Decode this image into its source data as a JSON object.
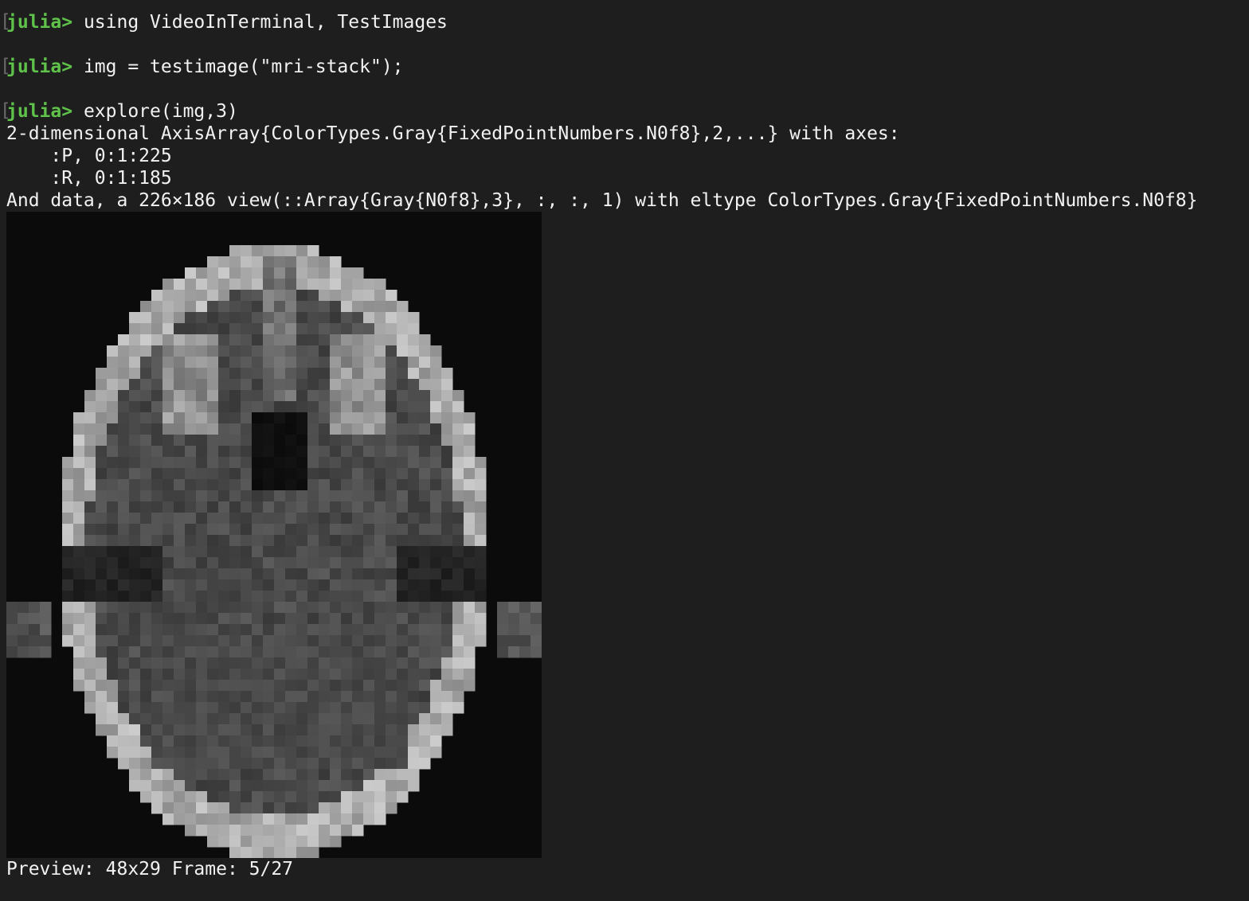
{
  "prompt": "julia>",
  "commands": [
    {
      "prompt": "julia>",
      "code": " using VideoInTerminal, TestImages"
    },
    {
      "prompt": "julia>",
      "code": " img = testimage(\"mri-stack\");"
    },
    {
      "prompt": "julia>",
      "code": " explore(img,3)"
    }
  ],
  "output": {
    "line1": "2-dimensional AxisArray{ColorTypes.Gray{FixedPointNumbers.N0f8},2,...} with axes:",
    "line2": "    :P, 0:1:225",
    "line3": "    :R, 0:1:185",
    "line4": "And data, a 226×186 view(::Array{Gray{N0f8},3}, :, :, 1) with eltype ColorTypes.Gray{FixedPointNumbers.N0f8}"
  },
  "preview": {
    "status": "Preview: 48x29 Frame: 5/27",
    "grid_cols": 48,
    "grid_rows": 58,
    "background": "#0b0b0b"
  },
  "colors": {
    "background": "#1e1e1e",
    "text": "#f2f2f2",
    "prompt": "#5fc24a"
  }
}
